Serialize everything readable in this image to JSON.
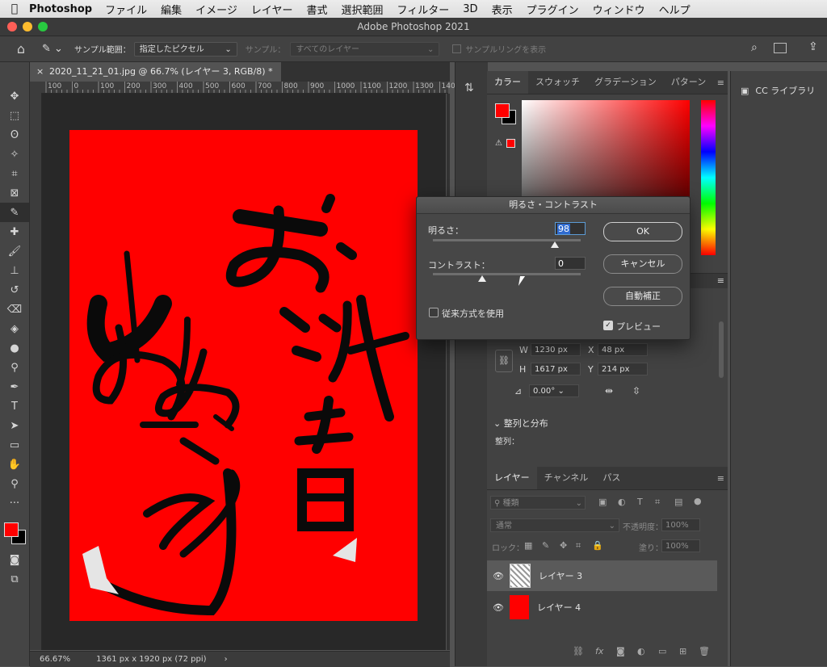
{
  "menubar": {
    "app_name": "Photoshop",
    "items": [
      "ファイル",
      "編集",
      "イメージ",
      "レイヤー",
      "書式",
      "選択範囲",
      "フィルター",
      "3D",
      "表示",
      "プラグイン",
      "ウィンドウ",
      "ヘルプ"
    ]
  },
  "window": {
    "title": "Adobe Photoshop 2021"
  },
  "options": {
    "sample_range_label": "サンプル範囲：",
    "sample_range_value": "指定したピクセル",
    "sample_label": "サンプル：",
    "sample_value": "すべてのレイヤー",
    "show_ring_label": "サンプルリングを表示"
  },
  "document": {
    "tab_title": "2020_11_21_01.jpg @ 66.7% (レイヤー 3, RGB/8) *",
    "ruler_ticks": [
      "100",
      "0",
      "100",
      "200",
      "300",
      "400",
      "500",
      "600",
      "700",
      "800",
      "900",
      "1000",
      "1100",
      "1200",
      "1300",
      "140"
    ],
    "zoom": "66.67%",
    "size_info": "1361 px x 1920 px (72 ppi)"
  },
  "color_panel": {
    "tabs": [
      "カラー",
      "スウォッチ",
      "グラデーション",
      "パターン"
    ],
    "foreground": "#ff0000",
    "background": "#000000"
  },
  "properties": {
    "w_label": "W",
    "w_value": "1230 px",
    "h_label": "H",
    "h_value": "1617 px",
    "x_label": "X",
    "x_value": "48 px",
    "y_label": "Y",
    "y_value": "214 px",
    "angle_value": "0.00°",
    "align_section": "整列と分布",
    "align_label": "整列："
  },
  "layers_panel": {
    "tabs": [
      "レイヤー",
      "チャンネル",
      "パス"
    ],
    "filter_placeholder": "種類",
    "blend_mode": "通常",
    "opacity_label": "不透明度：",
    "opacity_value": "100%",
    "lock_label": "ロック：",
    "fill_label": "塗り：",
    "fill_value": "100%",
    "layers": [
      {
        "name": "レイヤー 3",
        "selected": true
      },
      {
        "name": "レイヤー 4",
        "selected": false
      }
    ]
  },
  "cc_library": {
    "label": "CC ライブラリ"
  },
  "dialog": {
    "title": "明るさ・コントラスト",
    "brightness_label": "明るさ：",
    "brightness_value": "98",
    "contrast_label": "コントラスト：",
    "contrast_value": "0",
    "legacy_label": "従来方式を使用",
    "ok_label": "OK",
    "cancel_label": "キャンセル",
    "auto_label": "自動補正",
    "preview_label": "プレビュー"
  }
}
